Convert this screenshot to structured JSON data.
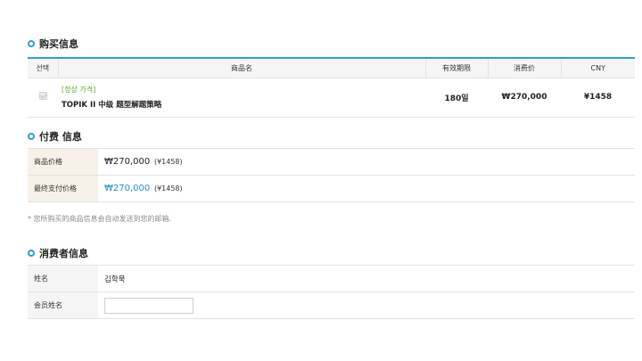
{
  "purchase_section": {
    "title": "购买信息"
  },
  "purchase_table": {
    "headers": {
      "select": "선택",
      "product": "商品名",
      "period": "有效期限",
      "price": "消费价",
      "cny": "CNY"
    },
    "row": {
      "tag": "[정상 가격]",
      "product": "TOPIK II 中级 题型解题策略",
      "period": "180일",
      "price": "₩270,000",
      "cny": "¥1458",
      "checked": true
    }
  },
  "payment_section": {
    "title": "付费 信息",
    "product_price_label": "商品价格",
    "product_price": "₩270,000",
    "product_price_cny": "(¥1458)",
    "final_price_label": "最终支付价格",
    "final_price": "₩270,000",
    "final_price_cny": "(¥1458)"
  },
  "note": "* 您所购买的商品信息会自动发送到您的邮箱.",
  "consumer_section": {
    "title": "消费者信息",
    "name_label": "姓名",
    "name_value": "김학묵",
    "member_name_label": "会员姓名",
    "member_name_value": ""
  },
  "colors": {
    "accent": "#2aa0d4",
    "tag_green": "#5ca832",
    "price_blue": "#2a8bc6"
  }
}
